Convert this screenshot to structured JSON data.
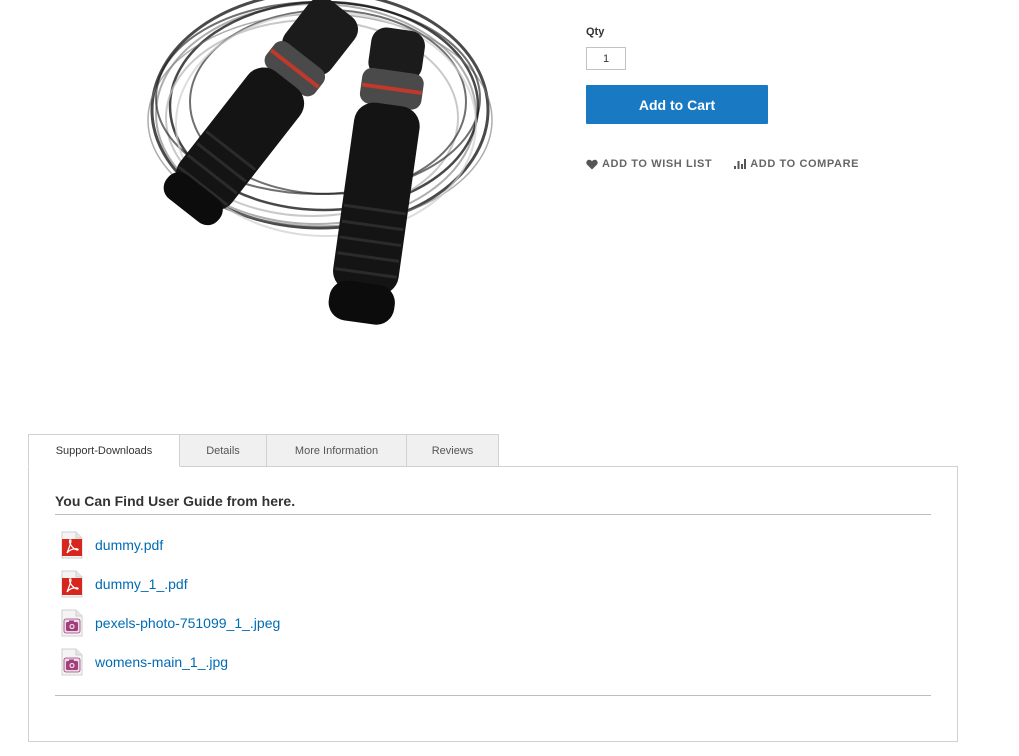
{
  "product": {
    "qty_label": "Qty",
    "qty_value": "1",
    "add_to_cart_label": "Add to Cart",
    "wishlist_label": "Add to Wish List",
    "compare_label": "Add to Compare",
    "image_icon": "jump-rope-product-photo"
  },
  "tabs": [
    {
      "label": "Support-Downloads",
      "active": true
    },
    {
      "label": "Details",
      "active": false
    },
    {
      "label": "More Information",
      "active": false
    },
    {
      "label": "Reviews",
      "active": false
    }
  ],
  "downloads": {
    "heading": "You Can Find User Guide from here.",
    "files": [
      {
        "name": "dummy.pdf",
        "icon": "pdf-file-icon"
      },
      {
        "name": "dummy_1_.pdf",
        "icon": "pdf-file-icon"
      },
      {
        "name": "pexels-photo-751099_1_.jpeg",
        "icon": "image-file-icon"
      },
      {
        "name": "womens-main_1_.jpg",
        "icon": "image-file-icon"
      }
    ]
  },
  "colors": {
    "primary_button": "#1979c3",
    "link": "#006bb4",
    "pdf_red": "#d7261e",
    "image_purple": "#a0407a"
  }
}
